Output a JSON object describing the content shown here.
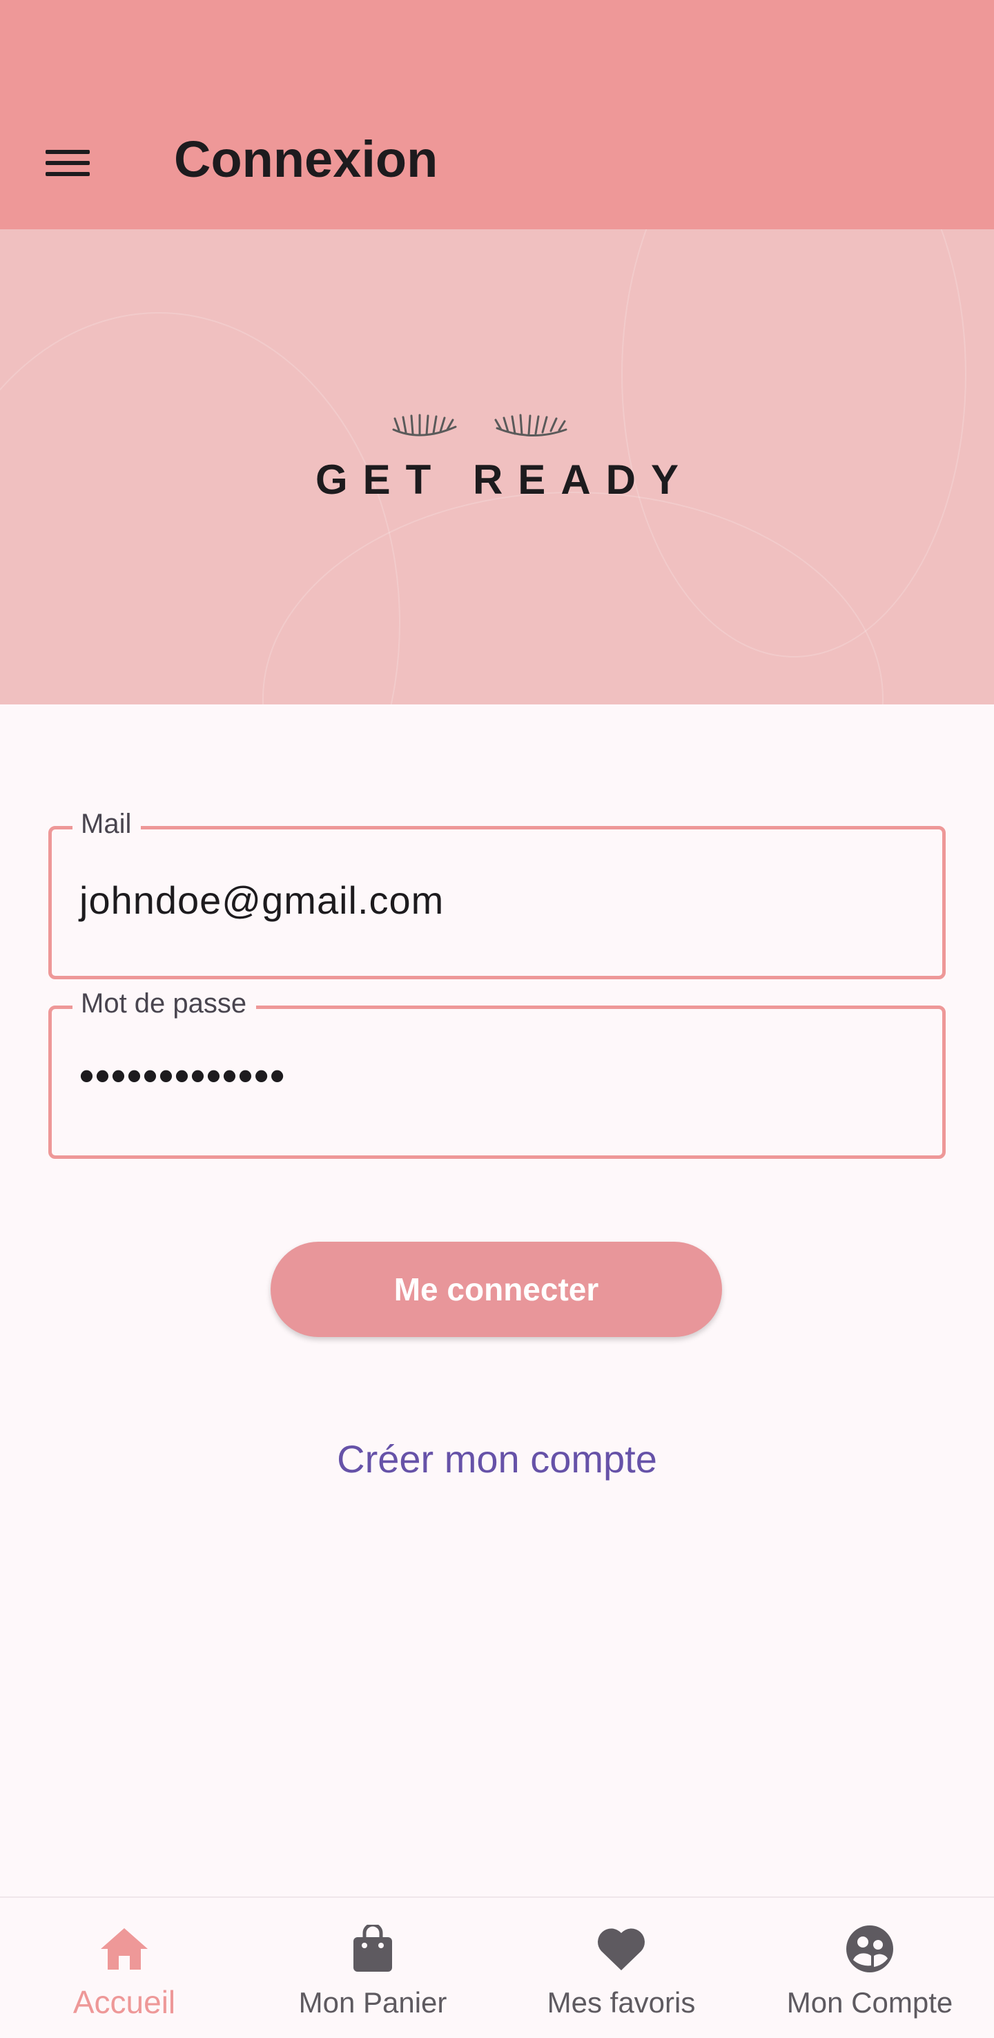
{
  "appbar": {
    "title": "Connexion",
    "menu_icon": "hamburger-menu-icon",
    "color": "#ee9898"
  },
  "hero": {
    "brand": "GET READY",
    "logo_icon": "eyelashes-icon",
    "color": "#f0c0c0"
  },
  "form": {
    "email": {
      "label": "Mail",
      "value": "johndoe@gmail.com"
    },
    "password": {
      "label": "Mot de passe",
      "value": "•••••••••••••"
    },
    "submit_label": "Me connecter",
    "create_account_label": "Créer mon compte"
  },
  "bottom_nav": {
    "items": [
      {
        "label": "Accueil",
        "icon": "home-icon",
        "active": true
      },
      {
        "label": "Mon Panier",
        "icon": "shopping-bag-icon",
        "active": false
      },
      {
        "label": "Mes favoris",
        "icon": "heart-icon",
        "active": false
      },
      {
        "label": "Mon Compte",
        "icon": "account-group-icon",
        "active": false
      }
    ]
  },
  "colors": {
    "accent": "#ee9898",
    "button": "#e8969a",
    "link": "#6652a8",
    "background": "#fef8fa"
  }
}
